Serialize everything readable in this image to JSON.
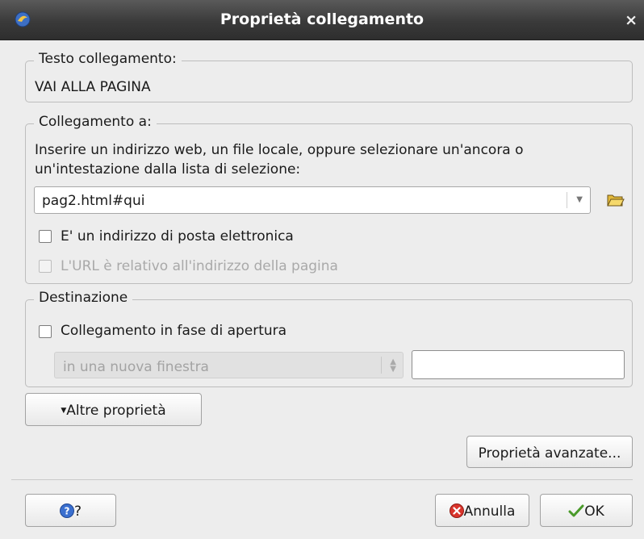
{
  "window": {
    "title": "Proprietà collegamento",
    "close_glyph": "×"
  },
  "link_text_group": {
    "legend": "Testo collegamento:",
    "value": "VAI ALLA PAGINA"
  },
  "link_to_group": {
    "legend": "Collegamento a:",
    "instruction_line1": "Inserire un indirizzo web, un file locale, oppure selezionare un'ancora o",
    "instruction_line2": "un'intestazione dalla lista di selezione:",
    "address_value": "pag2.html#qui",
    "email_checkbox_label": "E' un indirizzo di posta elettronica",
    "email_checked": false,
    "relative_url_label": "L'URL è relativo all'indirizzo della pagina",
    "relative_url_enabled": false
  },
  "destination_group": {
    "legend": "Destinazione",
    "open_link_label": "Collegamento in fase di apertura",
    "open_link_checked": false,
    "target_select_value": "in una nuova finestra",
    "target_name_value": ""
  },
  "buttons": {
    "more_properties": "Altre proprietà",
    "advanced_properties": "Proprietà avanzate...",
    "help": "?",
    "cancel": "Annulla",
    "ok": "OK"
  },
  "icons": {
    "app": "app-icon",
    "browse": "folder-open-icon",
    "help": "help-icon",
    "cancel": "cancel-icon",
    "ok": "checkmark-icon"
  }
}
